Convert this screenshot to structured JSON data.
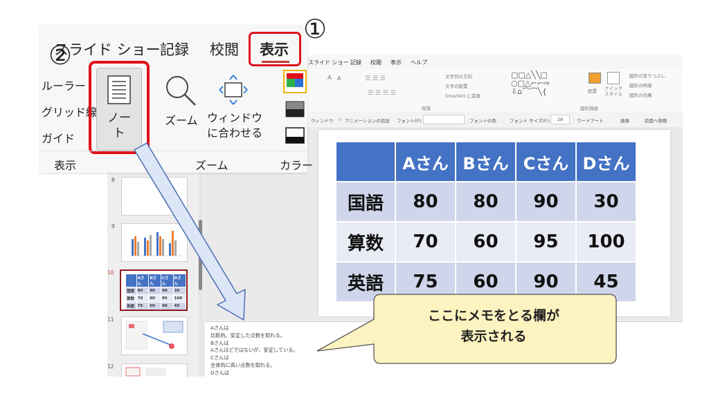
{
  "colors": {
    "accent_red": "#e0101a",
    "table_header": "#4472c4",
    "table_band_dark": "#cfd5ea",
    "table_band_light": "#e9ebf5",
    "callout_fill": "#fdf3c0",
    "callout_border": "#555555"
  },
  "step_markers": {
    "one": "①",
    "two": "②"
  },
  "zoom_ribbon": {
    "tabs": {
      "slideshow": "スライド ショー",
      "record": "記録",
      "review": "校閲",
      "view": "表示"
    },
    "show_group": {
      "ruler": "ルーラー",
      "gridlines": "グリッド線",
      "guides": "ガイド",
      "label": "表示"
    },
    "notes_button": "ノー\nト",
    "zoom_button": "ズーム",
    "fit_window_button": "ウィンドウ\nに合わせる",
    "zoom_group_label": "ズーム",
    "color_group_label": "カラー",
    "icons": [
      "notes-page-icon",
      "magnifier-icon",
      "fit-window-icon",
      "color-swatch-icon",
      "grayscale-icon",
      "black-white-icon"
    ]
  },
  "bg_app": {
    "tabs": [
      "スライド ショー",
      "記録",
      "校閲",
      "表示",
      "ヘルプ"
    ],
    "ribbon": {
      "font_size_a": "A",
      "font_size_a2": "A",
      "text_direction": "文字列の方向",
      "text_align": "文字の配置",
      "smartart": "SmartArt に変換",
      "paragraph_label": "段落",
      "arrange": "配置",
      "quick_style": "クイック\nスタイル",
      "shape_fill": "図形の塗りつぶし",
      "shape_outline": "図形の枠線",
      "shape_effect": "図形の効果",
      "drawing_label": "図形描画"
    },
    "qat": {
      "window": "ウィンドウ",
      "animation": "アニメーションの追加",
      "font": "フォント(F):",
      "font_color": "フォントの色",
      "font_size": "フォント サイズ(F):",
      "font_size_value": "28",
      "wordart": "ワードアート",
      "picture": "画像",
      "bring_forward": "前面へ移動"
    }
  },
  "thumbnails": [
    {
      "number": "8"
    },
    {
      "number": "9"
    },
    {
      "number": "10",
      "header": [
        "Aさん",
        "Bさん",
        "Cさん",
        "Dさん"
      ],
      "rows": [
        [
          "国語",
          "80",
          "80",
          "90",
          "30"
        ],
        [
          "算数",
          "70",
          "60",
          "95",
          "100"
        ],
        [
          "英語",
          "75",
          "60",
          "90",
          "45"
        ]
      ]
    },
    {
      "number": "11"
    },
    {
      "number": "12"
    }
  ],
  "slide_table": {
    "header": [
      "",
      "Aさん",
      "Bさん",
      "Cさん",
      "Dさん"
    ],
    "rows": [
      [
        "国語",
        "80",
        "80",
        "90",
        "30"
      ],
      [
        "算数",
        "70",
        "60",
        "95",
        "100"
      ],
      [
        "英語",
        "75",
        "60",
        "90",
        "45"
      ]
    ]
  },
  "notes": "Aさんは\n比較的、安定した点数を取れる。\nBさんは\nAさんほどではないが、安定している。\nCさんは\n全体的に高い点数を取れる。\nDさんは",
  "callout": {
    "line1": "ここにメモをとる欄が",
    "line2": "表示される"
  }
}
